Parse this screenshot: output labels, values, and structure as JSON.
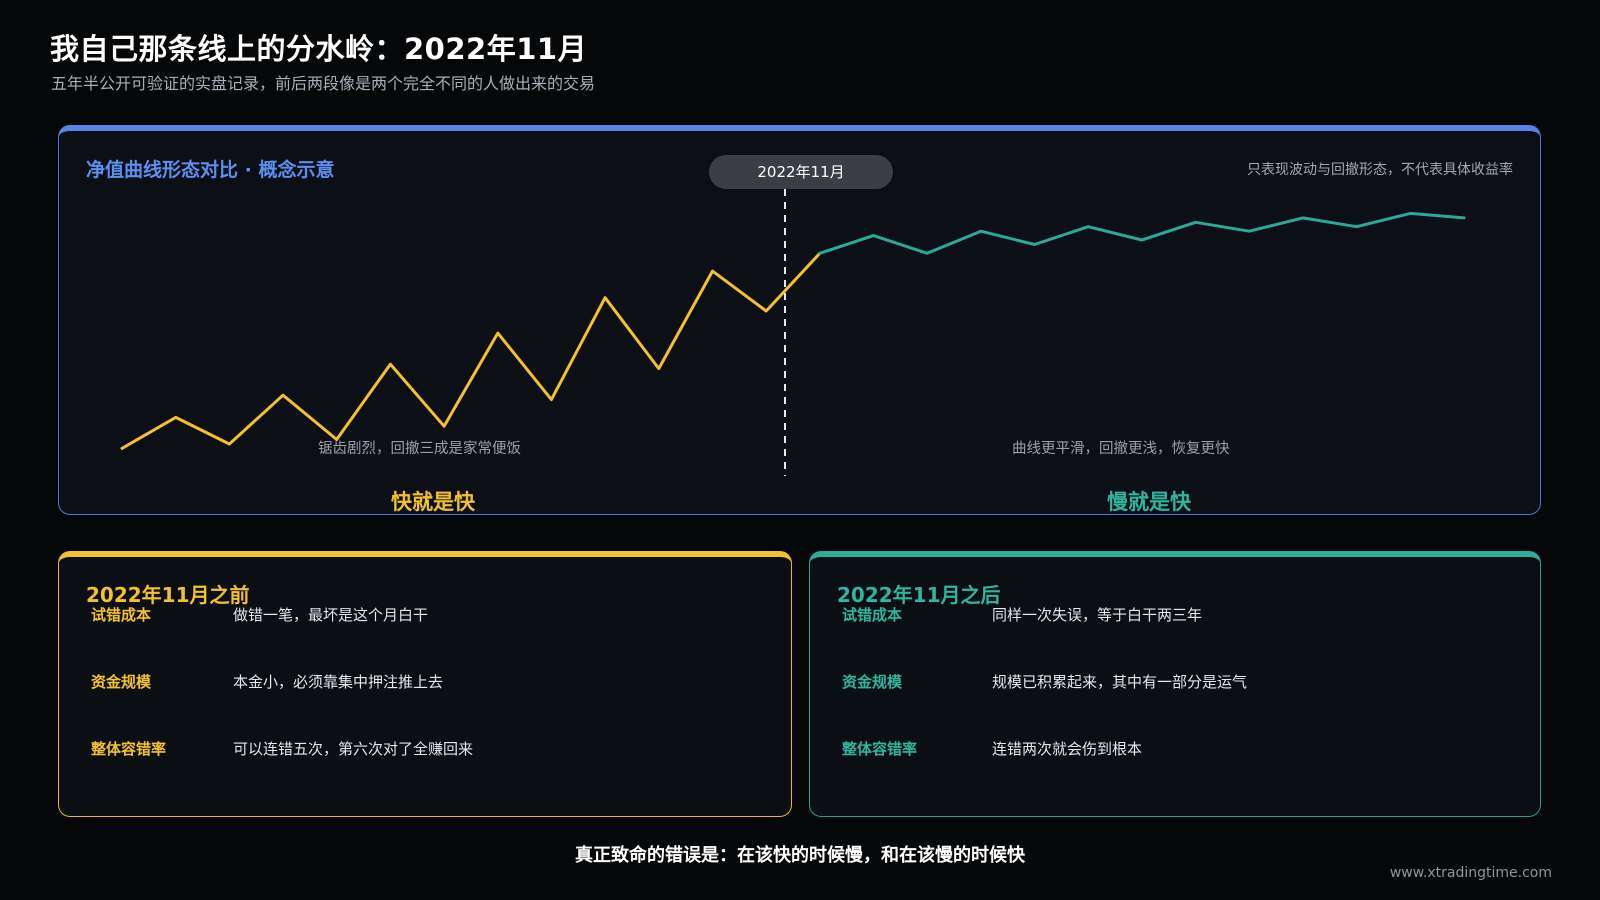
{
  "header": {
    "title": "我自己那条线上的分水岭：2022年11月",
    "subtitle": "五年半公开可验证的实盘记录，前后两段像是两个完全不同的人做出来的交易"
  },
  "chart_panel": {
    "title": "净值曲线形态对比 · 概念示意",
    "note": "只表现波动与回撤形态，不代表具体收益率",
    "divider_label": "2022年11月",
    "left_annotation": "锯齿剧烈，回撤三成是家常便饭",
    "right_annotation": "曲线更平滑，回撤更浅，恢复更快",
    "left_era": "快就是快",
    "right_era": "慢就是快"
  },
  "chart_data": {
    "type": "line",
    "title": "净值曲线形态对比 · 概念示意",
    "xlabel": "",
    "ylabel": "",
    "divider": "2022年11月",
    "series": [
      {
        "name": "",
        "color": "#f2c12e",
        "points": [
          [
            0,
            6
          ],
          [
            1,
            13
          ],
          [
            2,
            7
          ],
          [
            3,
            18
          ],
          [
            4,
            8
          ],
          [
            5,
            25
          ],
          [
            6,
            11
          ],
          [
            7,
            32
          ],
          [
            8,
            17
          ],
          [
            9,
            40
          ],
          [
            10,
            24
          ],
          [
            11,
            46
          ],
          [
            12,
            37
          ],
          [
            13,
            50
          ]
        ]
      },
      {
        "name": "",
        "color": "#2aa898",
        "points": [
          [
            13,
            50
          ],
          [
            14,
            54
          ],
          [
            15,
            50
          ],
          [
            16,
            55
          ],
          [
            17,
            52
          ],
          [
            18,
            56
          ],
          [
            19,
            53
          ],
          [
            20,
            57
          ],
          [
            21,
            55
          ],
          [
            22,
            58
          ],
          [
            23,
            56
          ],
          [
            24,
            59
          ],
          [
            25,
            58
          ]
        ]
      }
    ],
    "ylim": [
      0,
      60
    ]
  },
  "cards": {
    "before": {
      "title": "2022年11月之前",
      "rows": [
        {
          "label": "试错成本",
          "value": "做错一笔，最坏是这个月白干"
        },
        {
          "label": "资金规模",
          "value": "本金小，必须靠集中押注推上去"
        },
        {
          "label": "整体容错率",
          "value": "可以连错五次，第六次对了全赚回来"
        }
      ]
    },
    "after": {
      "title": "2022年11月之后",
      "rows": [
        {
          "label": "试错成本",
          "value": "同样一次失误，等于白干两三年"
        },
        {
          "label": "资金规模",
          "value": "规模已积累起来，其中有一部分是运气"
        },
        {
          "label": "整体容错率",
          "value": "连错两次就会伤到根本"
        }
      ]
    }
  },
  "conclusion": "真正致命的错误是：在该快的时候慢，和在该慢的时候快",
  "footer": "www.xtradingtime.com",
  "colors": {
    "background": "#060709",
    "accent_blue": "#5a82e3",
    "accent_yellow": "#f2c12e",
    "accent_teal": "#2aa898"
  }
}
